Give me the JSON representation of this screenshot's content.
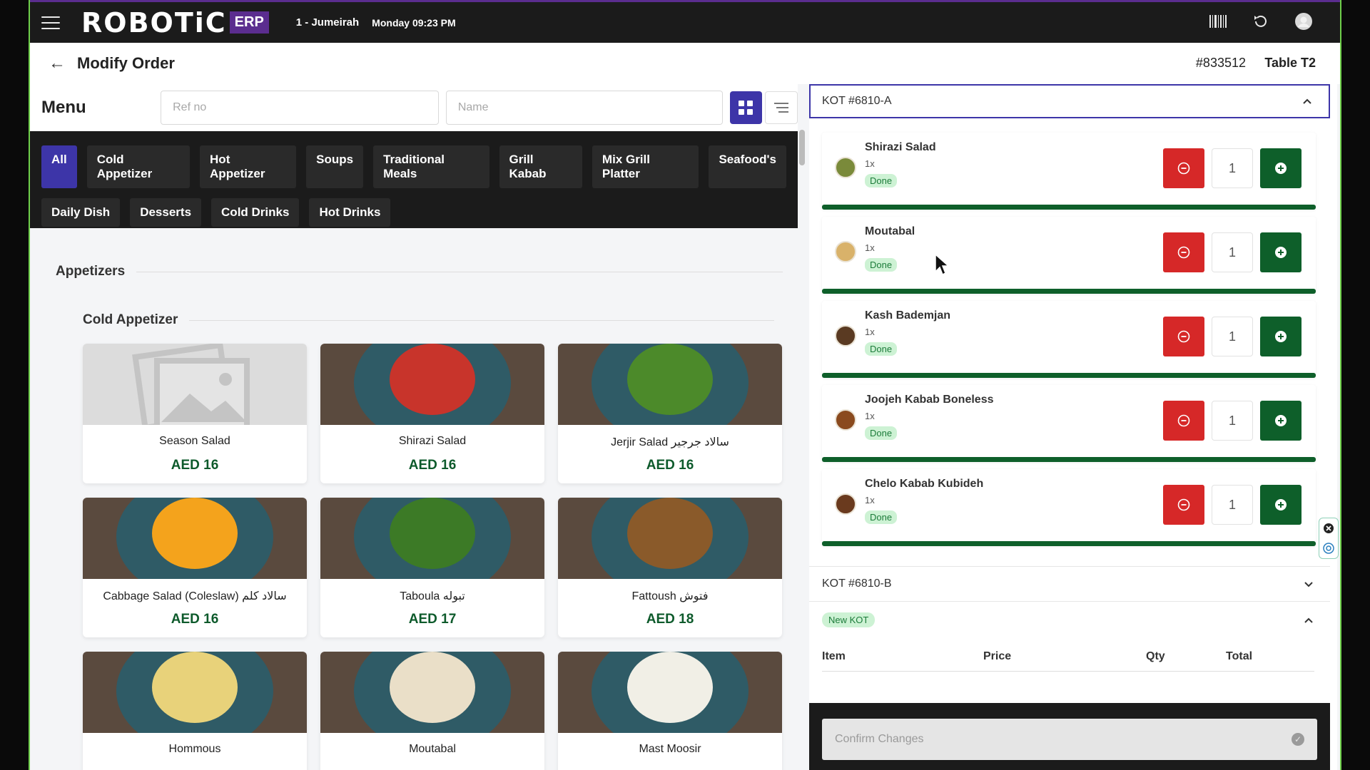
{
  "topbar": {
    "logo": "ROBOTiC",
    "logo_badge": "ERP",
    "branch": "1 - Jumeirah",
    "datetime": "Monday 09:23 PM",
    "icons": [
      "menu-icon",
      "barcode-icon",
      "refresh-icon",
      "user-avatar-icon"
    ]
  },
  "header": {
    "title": "Modify Order",
    "order_no": "#833512",
    "table": "Table T2"
  },
  "menu": {
    "title": "Menu",
    "ref_placeholder": "Ref no",
    "name_placeholder": "Name",
    "categories_row1": [
      "All",
      "Cold Appetizer",
      "Hot Appetizer",
      "Soups",
      "Traditional Meals",
      "Grill Kabab",
      "Mix Grill Platter",
      "Seafood's"
    ],
    "categories_row2": [
      "Daily Dish",
      "Desserts",
      "Cold Drinks",
      "Hot Drinks"
    ],
    "active_category": "All",
    "section": "Appetizers",
    "subsection": "Cold Appetizer",
    "items": [
      {
        "name": "Season Salad",
        "price": "AED 16"
      },
      {
        "name": "Shirazi Salad",
        "price": "AED 16"
      },
      {
        "name": "Jerjir Salad سالاد جرجير",
        "price": "AED 16"
      },
      {
        "name": "Cabbage Salad (Coleslaw) سالاد کلم",
        "price": "AED 16"
      },
      {
        "name": "Taboula تبوله",
        "price": "AED 17"
      },
      {
        "name": "Fattoush فتوش",
        "price": "AED 18"
      },
      {
        "name": "Hommous",
        "price": ""
      },
      {
        "name": "Moutabal",
        "price": ""
      },
      {
        "name": "Mast Moosir",
        "price": ""
      }
    ]
  },
  "kot_a": {
    "label": "KOT #6810-A",
    "items": [
      {
        "name": "Shirazi Salad",
        "qty_label": "1x",
        "status": "Done",
        "qty": "1"
      },
      {
        "name": "Moutabal",
        "qty_label": "1x",
        "status": "Done",
        "qty": "1"
      },
      {
        "name": "Kash Bademjan",
        "qty_label": "1x",
        "status": "Done",
        "qty": "1"
      },
      {
        "name": "Joojeh Kabab Boneless",
        "qty_label": "1x",
        "status": "Done",
        "qty": "1"
      },
      {
        "name": "Chelo Kabab Kubideh",
        "qty_label": "1x",
        "status": "Done",
        "qty": "1"
      }
    ]
  },
  "kot_b": {
    "label": "KOT #6810-B"
  },
  "new_kot": {
    "badge": "New KOT",
    "columns": [
      "Item",
      "Price",
      "Qty",
      "Total"
    ]
  },
  "footer": {
    "confirm_label": "Confirm Changes"
  },
  "colors": {
    "accent": "#3d35a8",
    "brand_purple": "#5b2d8f",
    "done_green": "#0e5f2a",
    "remove_red": "#d62828",
    "price_green": "#0d5a2b"
  }
}
